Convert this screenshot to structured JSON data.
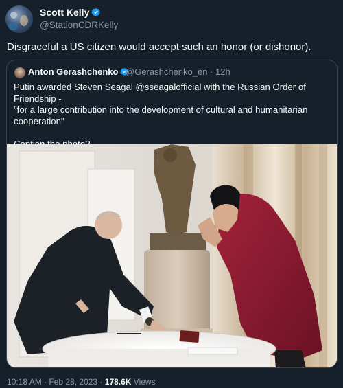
{
  "author": {
    "name": "Scott Kelly",
    "handle": "@StationCDRKelly"
  },
  "tweet": {
    "text": "Disgraceful a US citizen would accept such an honor (or dishonor)."
  },
  "quoted_tweet": {
    "name": "Anton Gerashchenko",
    "handle_time": "@Gerashchenko_en · 12h",
    "body_line1": "Putin awarded Steven Seagal @sseagalofficial with the Russian Order of Friendship -",
    "body_line2": "\"for a large contribution into the development of cultural and humanitarian cooperation\"",
    "body_line3": "Caption the photo?"
  },
  "meta": {
    "time_date": "10:18 AM · Feb 28, 2023 · ",
    "views_count": "178.6K",
    "views_label": " Views"
  },
  "colors": {
    "background": "#15202b",
    "text": "#f7f9f9",
    "secondary": "#8b98a5",
    "verified": "#1d9bf0",
    "border": "#38444d"
  }
}
